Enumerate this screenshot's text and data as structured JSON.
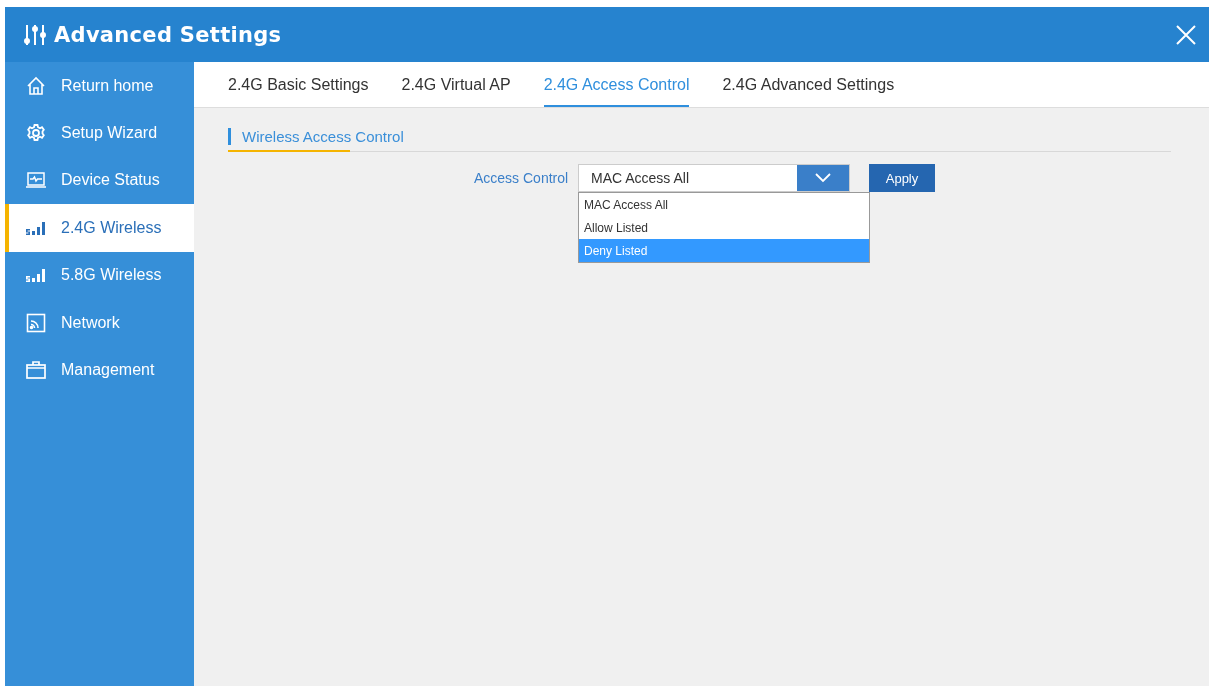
{
  "window": {
    "title": "Advanced Settings"
  },
  "sidebar": {
    "items": [
      {
        "label": "Return home",
        "selected": false
      },
      {
        "label": "Setup Wizard",
        "selected": false
      },
      {
        "label": "Device Status",
        "selected": false
      },
      {
        "label": "2.4G Wireless",
        "selected": true
      },
      {
        "label": "5.8G Wireless",
        "selected": false
      },
      {
        "label": "Network",
        "selected": false
      },
      {
        "label": "Management",
        "selected": false
      }
    ]
  },
  "tabs": [
    {
      "label": "2.4G Basic Settings",
      "selected": false
    },
    {
      "label": "2.4G Virtual AP",
      "selected": false
    },
    {
      "label": "2.4G Access Control",
      "selected": true
    },
    {
      "label": "2.4G Advanced Settings",
      "selected": false
    }
  ],
  "section": {
    "title": "Wireless Access Control"
  },
  "form": {
    "label": "Access Control",
    "value": "MAC Access All",
    "expanded": true,
    "options": [
      {
        "label": "MAC Access All",
        "highlighted": false
      },
      {
        "label": "Allow Listed",
        "highlighted": false
      },
      {
        "label": "Deny Listed",
        "highlighted": true
      }
    ],
    "apply_button": "Apply"
  }
}
